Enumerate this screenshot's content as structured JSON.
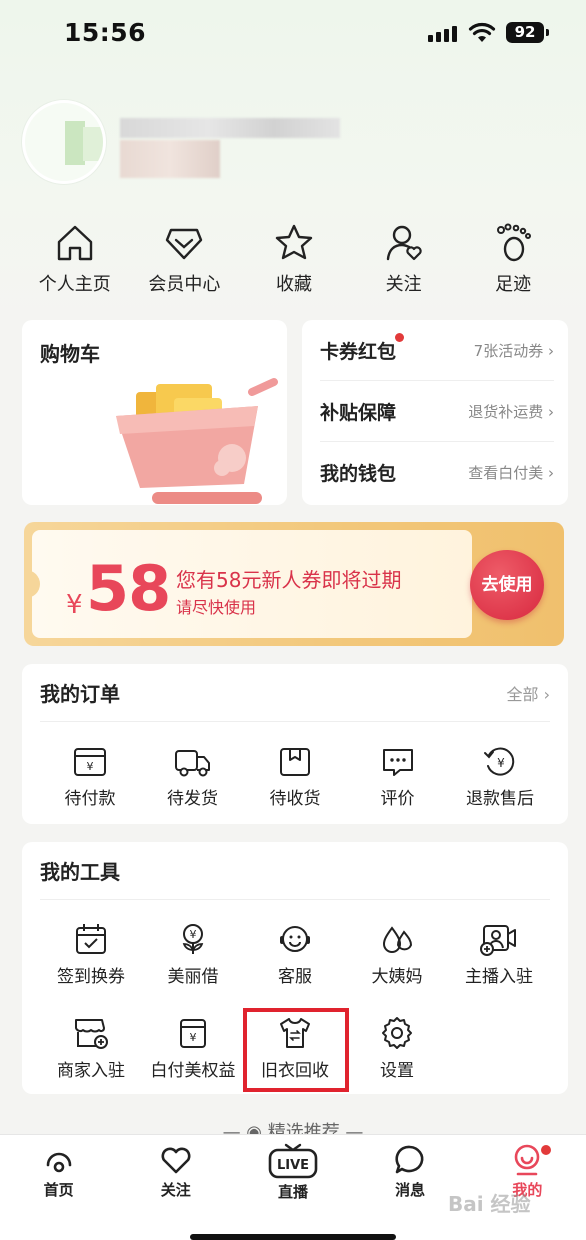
{
  "status": {
    "time": "15:56",
    "battery": "92"
  },
  "quick": [
    {
      "label": "个人主页",
      "icon": "home-icon"
    },
    {
      "label": "会员中心",
      "icon": "member-icon"
    },
    {
      "label": "收藏",
      "icon": "star-icon"
    },
    {
      "label": "关注",
      "icon": "follow-icon"
    },
    {
      "label": "足迹",
      "icon": "footprint-icon"
    }
  ],
  "cart": {
    "title": "购物车"
  },
  "side_list": [
    {
      "label": "卡券红包",
      "value": "7张活动券"
    },
    {
      "label": "补贴保障",
      "value": "退货补运费"
    },
    {
      "label": "我的钱包",
      "value": "查看白付美"
    }
  ],
  "coupon": {
    "currency": "¥",
    "amount": "58",
    "main": "您有58元新人券即将过期",
    "sub": "请尽快使用",
    "button": "去使用"
  },
  "orders": {
    "title": "我的订单",
    "more": "全部",
    "items": [
      {
        "label": "待付款",
        "icon": "pending-payment-icon"
      },
      {
        "label": "待发货",
        "icon": "truck-icon"
      },
      {
        "label": "待收货",
        "icon": "package-icon"
      },
      {
        "label": "评价",
        "icon": "review-icon"
      },
      {
        "label": "退款售后",
        "icon": "refund-icon"
      }
    ]
  },
  "tools": {
    "title": "我的工具",
    "items": [
      {
        "label": "签到换券",
        "icon": "calendar-check-icon"
      },
      {
        "label": "美丽借",
        "icon": "flower-yen-icon"
      },
      {
        "label": "客服",
        "icon": "headset-icon"
      },
      {
        "label": "大姨妈",
        "icon": "drops-icon"
      },
      {
        "label": "主播入驻",
        "icon": "camera-user-icon"
      },
      {
        "label": "商家入驻",
        "icon": "store-icon"
      },
      {
        "label": "白付美权益",
        "icon": "wallet-yen-icon"
      },
      {
        "label": "旧衣回收",
        "icon": "shirt-recycle-icon"
      },
      {
        "label": "设置",
        "icon": "gear-icon"
      }
    ]
  },
  "recommend": "— ◉ 精选推荐 —",
  "tabs": [
    {
      "label": "首页"
    },
    {
      "label": "关注"
    },
    {
      "label": "直播",
      "badge": "LIVE"
    },
    {
      "label": "消息"
    },
    {
      "label": "我的"
    }
  ],
  "watermark": "Bai 经验",
  "colors": {
    "accent": "#e8475a",
    "highlight": "#e0232e"
  }
}
